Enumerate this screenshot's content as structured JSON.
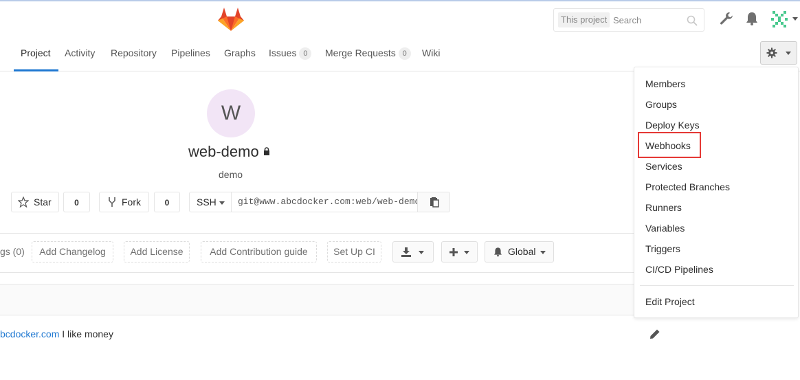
{
  "header": {
    "search": {
      "scope": "This project",
      "placeholder": "Search"
    }
  },
  "nav": {
    "tabs": [
      {
        "label": "Project"
      },
      {
        "label": "Activity"
      },
      {
        "label": "Repository"
      },
      {
        "label": "Pipelines"
      },
      {
        "label": "Graphs"
      },
      {
        "label": "Issues",
        "count": "0"
      },
      {
        "label": "Merge Requests",
        "count": "0"
      },
      {
        "label": "Wiki"
      }
    ],
    "active_tab": "Project"
  },
  "project": {
    "avatar_letter": "W",
    "name": "web-demo",
    "description": "demo",
    "star_label": "Star",
    "star_count": "0",
    "fork_label": "Fork",
    "fork_count": "0",
    "clone_protocol": "SSH",
    "clone_url": "git@www.abcdocker.com:web/web-demo.git"
  },
  "actions": {
    "tags_partial": "gs (0)",
    "add_changelog": "Add Changelog",
    "add_license": "Add License",
    "add_contribution": "Add Contribution guide",
    "set_up_ci": "Set Up CI",
    "notification_level": "Global"
  },
  "commit": {
    "link_text": "bcdocker.com",
    "message": " I like money"
  },
  "settings_menu": {
    "items": [
      "Members",
      "Groups",
      "Deploy Keys",
      "Webhooks",
      "Services",
      "Protected Branches",
      "Runners",
      "Variables",
      "Triggers",
      "CI/CD Pipelines"
    ],
    "edit_project": "Edit Project",
    "highlighted": "Webhooks"
  },
  "colors": {
    "accent": "#1f78d1",
    "highlight": "#e53935",
    "logo": "#fc6d26"
  }
}
